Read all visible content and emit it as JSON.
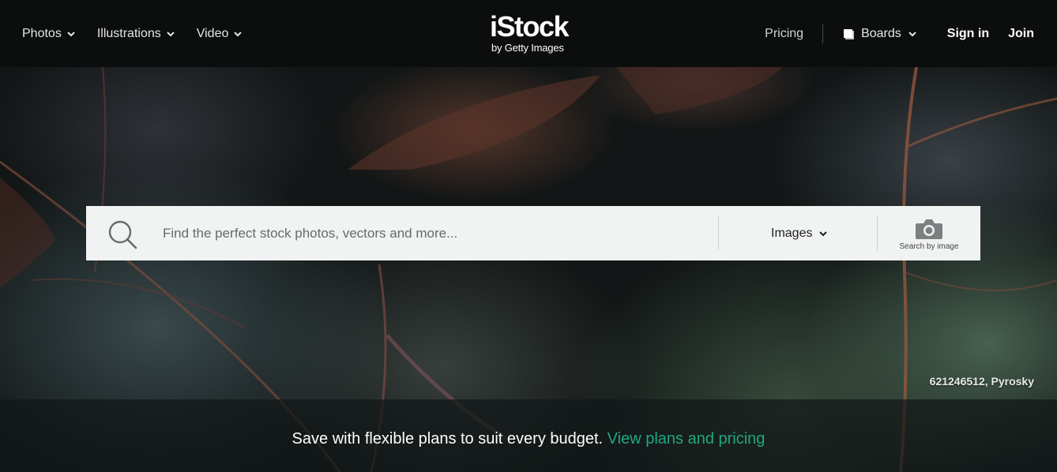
{
  "nav": {
    "left_items": [
      {
        "label": "Photos"
      },
      {
        "label": "Illustrations"
      },
      {
        "label": "Video"
      }
    ],
    "logo_main": "iStock",
    "logo_sub": "by Getty Images",
    "pricing": "Pricing",
    "boards": "Boards",
    "sign_in": "Sign in",
    "join": "Join"
  },
  "search": {
    "placeholder": "Find the perfect stock photos, vectors and more...",
    "value": "",
    "type_selected": "Images",
    "by_image_label": "Search by image"
  },
  "hero": {
    "credit": "621246512, Pyrosky"
  },
  "promo": {
    "text": "Save with flexible plans to suit every budget.",
    "link": "View plans and pricing"
  },
  "colors": {
    "nav_bg": "#0c0d0d",
    "accent_link": "#1fa880",
    "search_bg": "#f1f3f3"
  },
  "icons": {
    "search": "search-icon",
    "camera": "camera-icon",
    "boards": "boards-icon",
    "chevron": "chevron-down-icon"
  }
}
